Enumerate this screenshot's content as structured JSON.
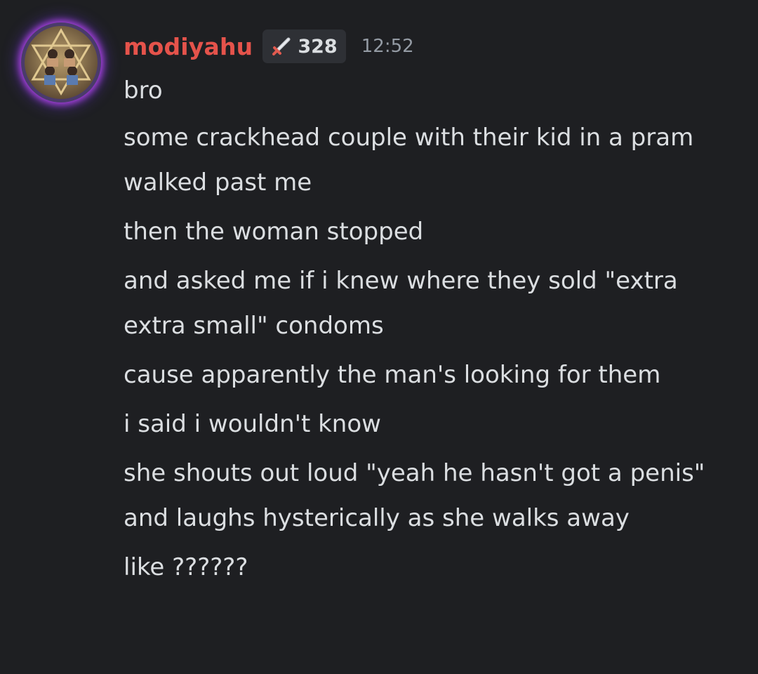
{
  "message": {
    "username": "modiyahu",
    "badge": {
      "icon": "sword-icon",
      "count": "328"
    },
    "timestamp": "12:52",
    "lines": [
      "bro",
      "some crackhead couple with their kid in a pram walked past me",
      "then the woman stopped",
      "and asked me if i knew where they sold \"extra extra small\" condoms",
      "cause apparently the man's looking for them",
      "i said i wouldn't know",
      "she shouts out loud \"yeah he hasn't got a penis\" and laughs hysterically as she walks away",
      "like ??????"
    ]
  },
  "colors": {
    "background": "#1e1f22",
    "username": "#e5534b",
    "text": "#dbdee1",
    "timestamp": "#949ba4",
    "badge_bg": "#2e3035",
    "avatar_glow": "#c446ff"
  }
}
